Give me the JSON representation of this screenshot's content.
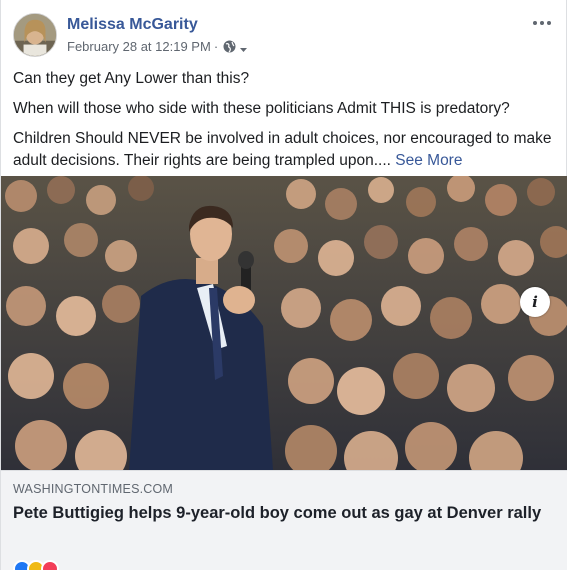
{
  "post": {
    "author": "Melissa McGarity",
    "timestamp": "February 28 at 12:19 PM",
    "separator": "·",
    "privacy_icon": "globe-icon",
    "menu_icon": "more-horizontal-icon",
    "paragraphs": [
      "Can they get Any Lower than this?",
      "When will those who side with these politicians Admit THIS is predatory?",
      "Children Should NEVER be involved in adult choices, nor encouraged to make adult decisions. Their rights are being trampled upon.... "
    ],
    "see_more": "See More"
  },
  "link": {
    "domain": "WASHINGTONTIMES.COM",
    "headline": "Pete Buttigieg helps 9-year-old boy come out as gay at Denver rally",
    "info_icon": "info-icon",
    "info_label": "i"
  },
  "colors": {
    "author": "#385898",
    "text": "#1c1e21",
    "meta": "#606770",
    "link_bg": "#f2f3f5"
  }
}
